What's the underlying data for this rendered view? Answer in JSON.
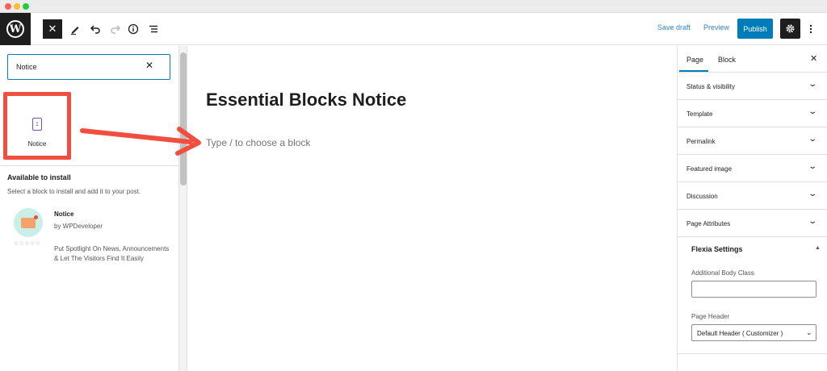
{
  "toolbar": {
    "logo_letter": "W",
    "close_glyph": "✕",
    "save_draft": "Save draft",
    "preview": "Preview",
    "publish": "Publish"
  },
  "inserter": {
    "search_value": "Notice",
    "clear_glyph": "✕",
    "result_block": {
      "label": "Notice",
      "icon": "notice-icon"
    },
    "available_title": "Available to install",
    "available_desc": "Select a block to install and add it to your post.",
    "plugin": {
      "name": "Notice",
      "author": "by WPDeveloper",
      "rating": "☆☆☆☆☆",
      "description": "Put Spotlight On News, Announcements & Let The Visitors Find It Easily"
    }
  },
  "editor": {
    "title": "Essential Blocks Notice",
    "placeholder": "Type / to choose a block"
  },
  "sidebar": {
    "tabs": [
      "Page",
      "Block"
    ],
    "close_glyph": "✕",
    "panels": [
      "Status & visibility",
      "Template",
      "Permalink",
      "Featured image",
      "Discussion",
      "Page Attributes"
    ],
    "flexia": {
      "title": "Flexia Settings",
      "body_class_label": "Additional Body Class",
      "body_class_value": "",
      "page_header_label": "Page Header",
      "page_header_value": "Default Header ( Customizer )"
    }
  },
  "colors": {
    "accent": "#007cba",
    "annotation": "#f04e3e",
    "dark": "#1e1e1e"
  }
}
